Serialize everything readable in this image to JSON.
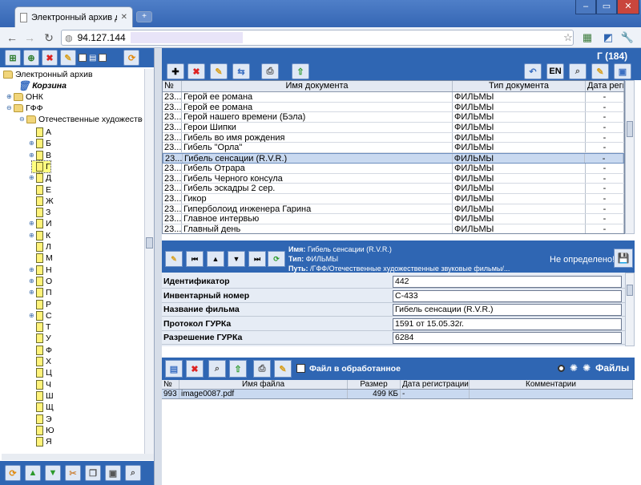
{
  "browser": {
    "tab_title": "Электронный архив доку...",
    "address": "94.127.144",
    "win_minimize": "–",
    "win_maximize": "▭",
    "win_close": "✕"
  },
  "left_panel": {
    "tree": {
      "root": "Электронный архив",
      "trash": "Корзина",
      "onk": "ОНК",
      "gff": "ГФФ",
      "category": "Отечественные художестве",
      "letters": [
        "А",
        "Б",
        "В",
        "Г",
        "Д",
        "Е",
        "Ж",
        "З",
        "И",
        "К",
        "Л",
        "М",
        "Н",
        "О",
        "П",
        "Р",
        "С",
        "Т",
        "У",
        "Ф",
        "Х",
        "Ц",
        "Ч",
        "Ш",
        "Щ",
        "Э",
        "Ю",
        "Я"
      ]
    }
  },
  "documents": {
    "header_title": "Г (184)",
    "lang_button": "EN",
    "columns": [
      "№",
      "Имя документа",
      "Тип документа",
      "Дата регист"
    ],
    "rows": [
      {
        "num": "23...",
        "name": "Герой ее романа",
        "type": "ФИЛЬМЫ",
        "date": "-"
      },
      {
        "num": "23...",
        "name": "Герой ее романа",
        "type": "ФИЛЬМЫ",
        "date": "-"
      },
      {
        "num": "23...",
        "name": "Герой нашего времени (Бэла)",
        "type": "ФИЛЬМЫ",
        "date": "-"
      },
      {
        "num": "23...",
        "name": "Герои Шипки",
        "type": "ФИЛЬМЫ",
        "date": "-"
      },
      {
        "num": "23...",
        "name": "Гибель во имя рождения",
        "type": "ФИЛЬМЫ",
        "date": "-"
      },
      {
        "num": "23...",
        "name": "Гибель \"Орла\"",
        "type": "ФИЛЬМЫ",
        "date": "-"
      },
      {
        "num": "23...",
        "name": "Гибель сенсации (R.V.R.)",
        "type": "ФИЛЬМЫ",
        "date": "-"
      },
      {
        "num": "23...",
        "name": "Гибель Отрара",
        "type": "ФИЛЬМЫ",
        "date": "-"
      },
      {
        "num": "23...",
        "name": "Гибель Черного консула",
        "type": "ФИЛЬМЫ",
        "date": "-"
      },
      {
        "num": "23...",
        "name": "Гибель эскадры 2 сер.",
        "type": "ФИЛЬМЫ",
        "date": "-"
      },
      {
        "num": "23...",
        "name": "Гикор",
        "type": "ФИЛЬМЫ",
        "date": "-"
      },
      {
        "num": "23...",
        "name": "Гиперболоид инженера Гарина",
        "type": "ФИЛЬМЫ",
        "date": "-"
      },
      {
        "num": "23...",
        "name": "Главное интервью",
        "type": "ФИЛЬМЫ",
        "date": "-"
      },
      {
        "num": "23...",
        "name": "Главный день",
        "type": "ФИЛЬМЫ",
        "date": "-"
      }
    ]
  },
  "detail": {
    "name_label": "Имя:",
    "name_value": "Гибель сенсации (R.V.R.)",
    "type_label": "Тип:",
    "type_value": "ФИЛЬМЫ",
    "path_label": "Путь:",
    "path_value": "/ГФФ/Отечественные художественные звуковые фильмы/...",
    "status": "Не определено!",
    "fields": [
      {
        "label": "Идентификатор",
        "value": "442"
      },
      {
        "label": "Инвентарный номер",
        "value": "С-433"
      },
      {
        "label": "Название фильма",
        "value": "Гибель сенсации (R.V.R.)"
      },
      {
        "label": "Протокол ГУРКа",
        "value": "1591 от 15.05.32г."
      },
      {
        "label": "Разрешение ГУРКа",
        "value": "6284"
      }
    ]
  },
  "files": {
    "processed_label": "Файл в обработанное",
    "view_label": "Файлы",
    "columns": [
      "№",
      "Имя файла",
      "Размер",
      "Дата регистрации",
      "Комментарии"
    ],
    "rows": [
      {
        "num": "993",
        "name": "image0087.pdf",
        "size": "499 КБ",
        "date": "-",
        "comment": ""
      }
    ]
  }
}
